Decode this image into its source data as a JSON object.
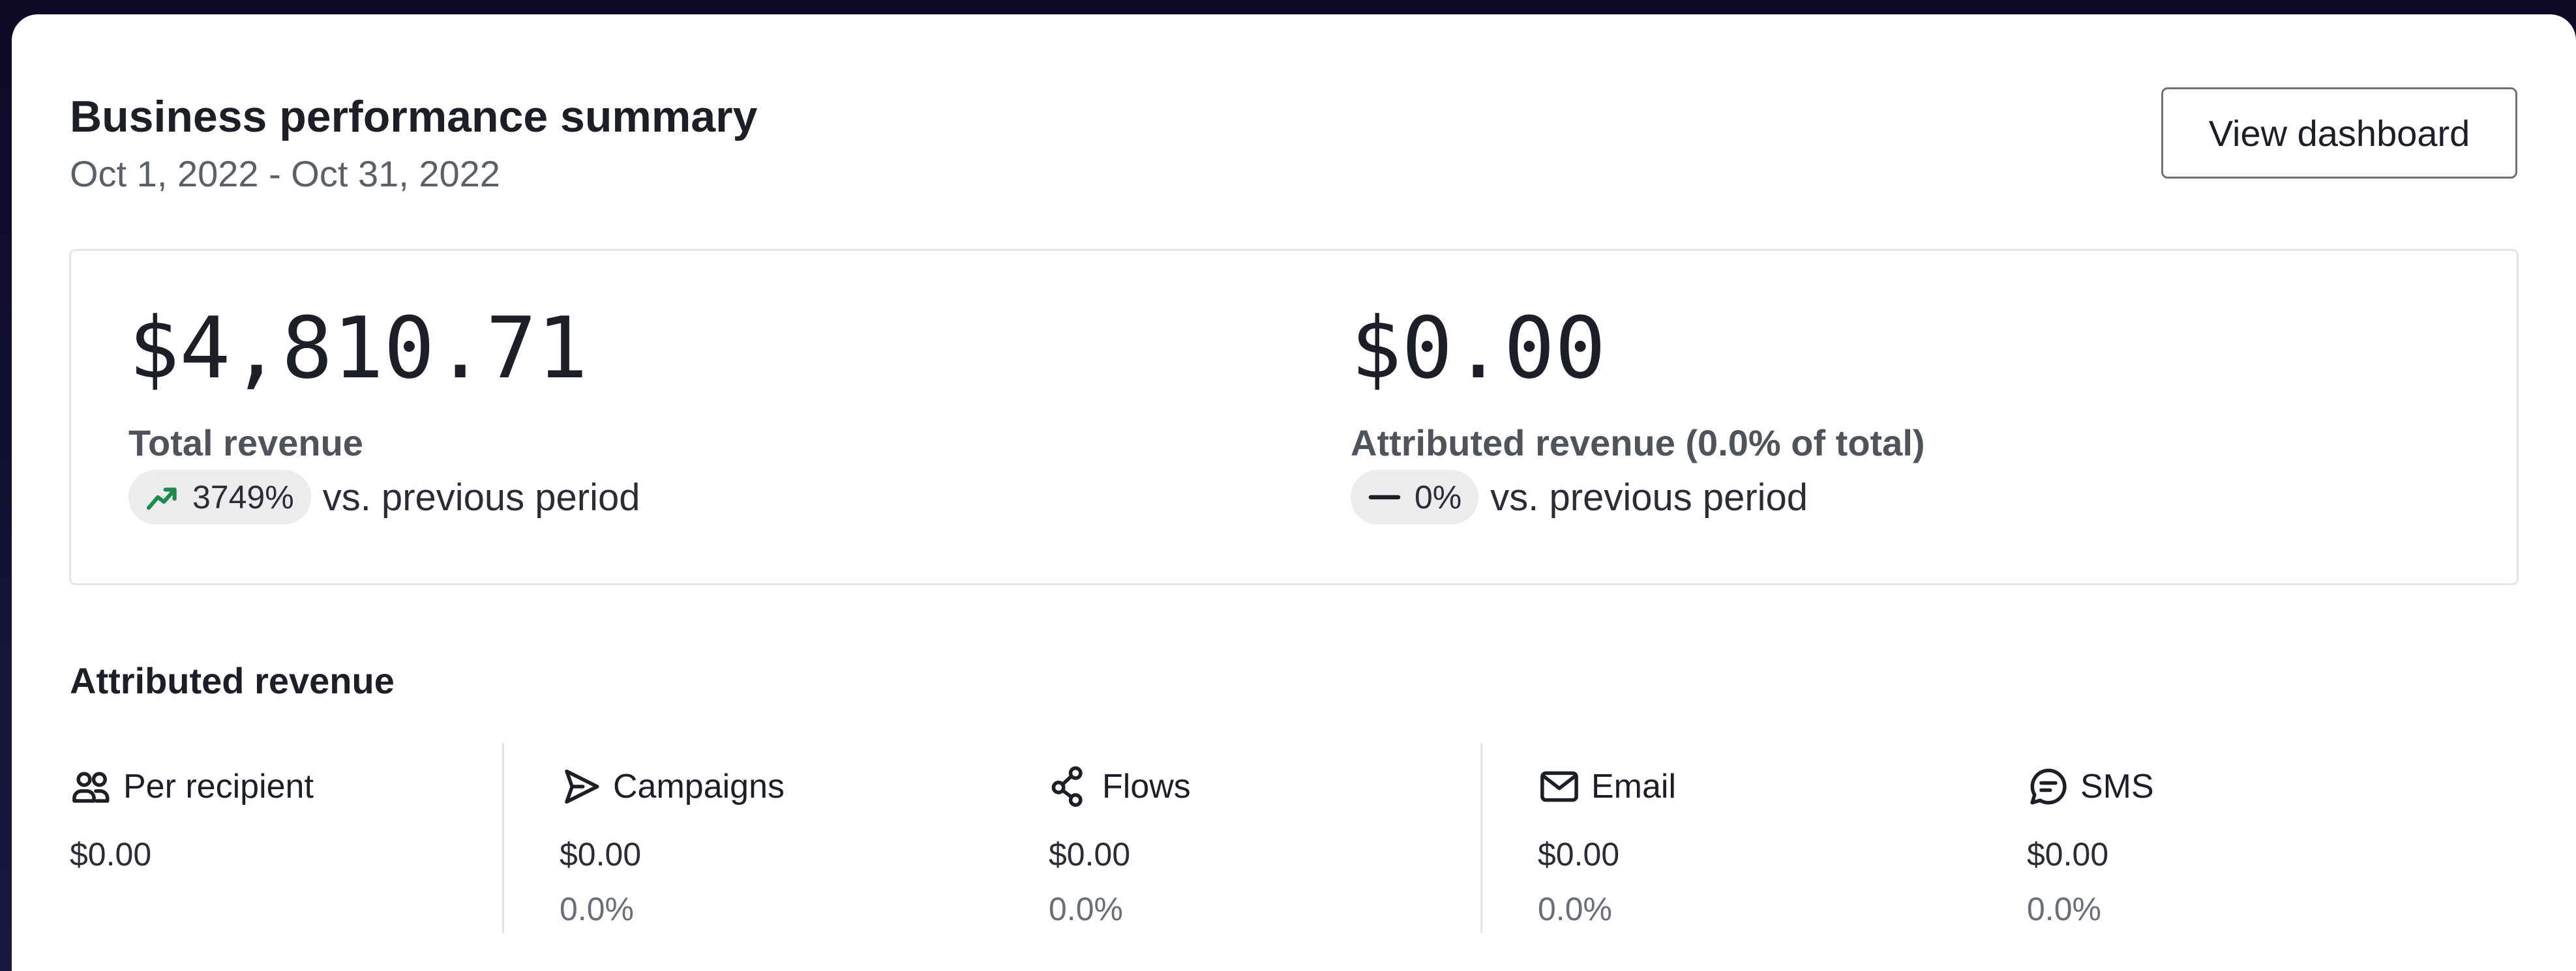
{
  "header": {
    "title": "Business performance summary",
    "date_range": "Oct 1, 2022 - Oct 31, 2022",
    "view_dashboard_label": "View dashboard"
  },
  "metrics": {
    "total": {
      "value": "$4,810.71",
      "label": "Total revenue",
      "change": "3749%",
      "change_icon": "trend-up-icon",
      "change_color": "#1f8a4c",
      "comparison": "vs. previous period"
    },
    "attributed": {
      "value": "$0.00",
      "label": "Attributed revenue (0.0% of total)",
      "change": "0%",
      "change_icon": "no-change-dash-icon",
      "comparison": "vs. previous period"
    }
  },
  "attributed_section": {
    "title": "Attributed revenue",
    "columns": [
      {
        "label": "Per recipient",
        "icon": "users-icon",
        "amount": "$0.00",
        "percent": ""
      },
      {
        "label": "Campaigns",
        "icon": "send-icon",
        "amount": "$0.00",
        "percent": "0.0%"
      },
      {
        "label": "Flows",
        "icon": "flows-icon",
        "amount": "$0.00",
        "percent": "0.0%"
      },
      {
        "label": "Email",
        "icon": "mail-icon",
        "amount": "$0.00",
        "percent": "0.0%"
      },
      {
        "label": "SMS",
        "icon": "sms-icon",
        "amount": "$0.00",
        "percent": "0.0%"
      }
    ]
  }
}
